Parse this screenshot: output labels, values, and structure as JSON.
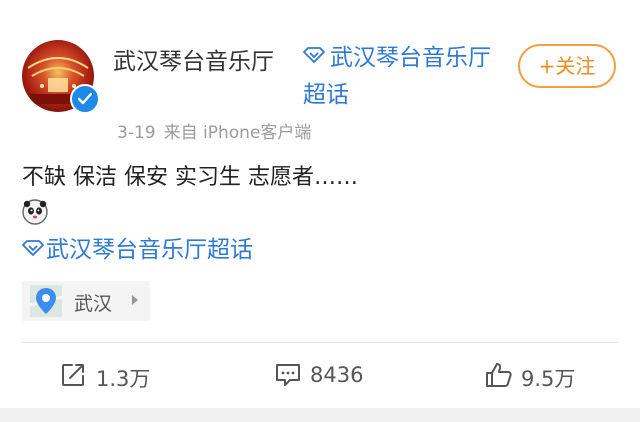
{
  "post": {
    "author_name": "武汉琴台音乐厅",
    "super_topic": "武汉琴台音乐厅超话",
    "follow_label": "+关注",
    "date": "3-19",
    "source": "来自 iPhone客户端",
    "text": "不缺 保洁 保安 实习生 志愿者……",
    "topic_link": "武汉琴台音乐厅超话",
    "location": "武汉"
  },
  "actions": {
    "repost_count": "1.3万",
    "comment_count": "8436",
    "like_count": "9.5万"
  },
  "icons": {
    "verified": "verified-badge-icon",
    "super_topic": "diamond-icon",
    "location": "map-pin-icon",
    "repost": "share-icon",
    "comment": "comment-icon",
    "like": "thumbs-up-icon",
    "sticker": "panda-sticker-icon"
  },
  "colors": {
    "link_blue": "#2e79d8",
    "follow_orange": "#f08b1f",
    "verified_blue": "#1c8be8",
    "meta_gray": "#9b9b9b"
  }
}
